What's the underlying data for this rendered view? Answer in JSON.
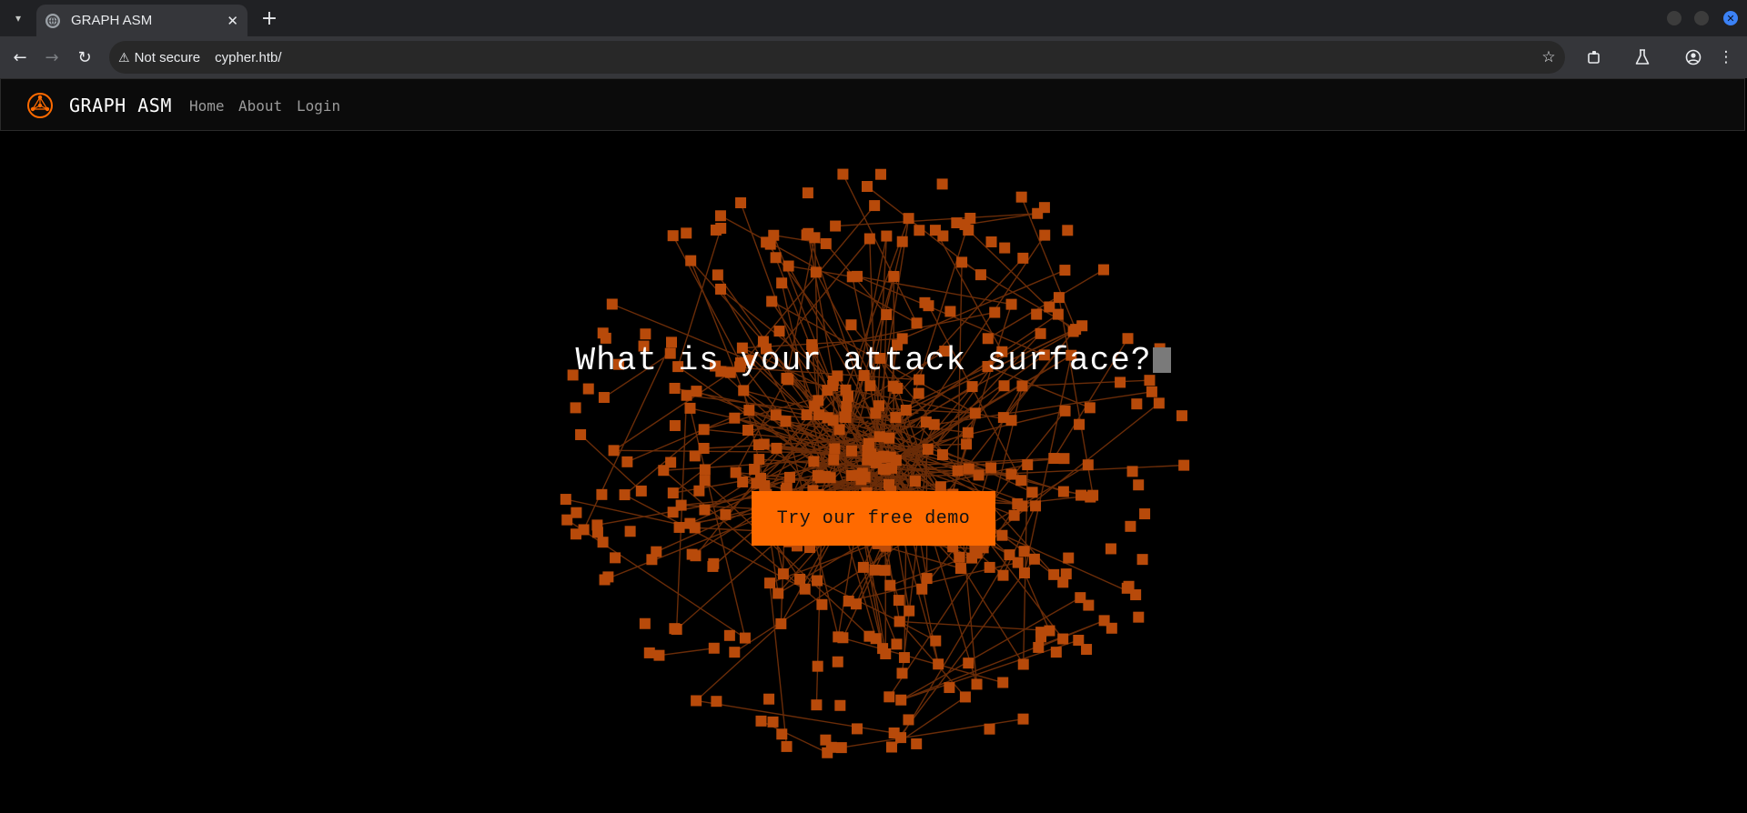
{
  "browser": {
    "tab_title": "GRAPH ASM",
    "tab_close": "✕",
    "new_tab": "+",
    "security_label": "Not secure",
    "url": "cypher.htb/"
  },
  "site": {
    "brand": "GRAPH ASM",
    "nav": [
      "Home",
      "About",
      "Login"
    ],
    "accent_color": "#ff6a00",
    "node_color": "#b84a0a"
  },
  "hero": {
    "title": "What is your attack surface?",
    "cta_label": "Try our free demo"
  }
}
